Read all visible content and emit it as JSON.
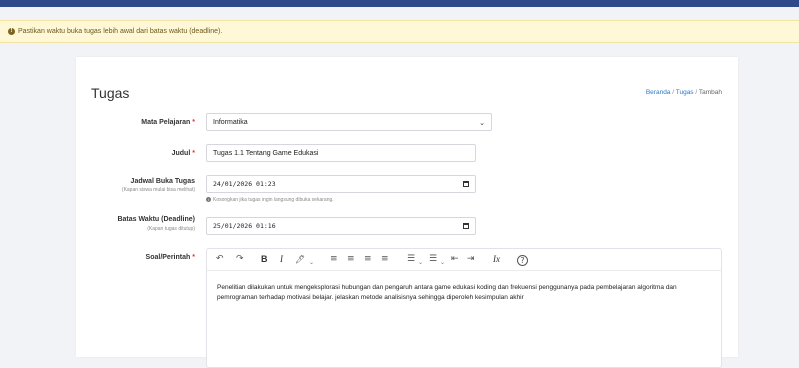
{
  "alert": {
    "icon": "alert-circle-icon",
    "text": "Pastikan waktu buka tugas lebih awal dari batas waktu (deadline)."
  },
  "page": {
    "title": "Tugas",
    "breadcrumb": [
      "Beranda",
      "Tugas",
      "Tambah"
    ]
  },
  "form": {
    "mata_pelajaran": {
      "label": "Mata Pelajaran",
      "value": "Informatika"
    },
    "judul": {
      "label": "Judul",
      "value": "Tugas 1.1 Tentang Game Edukasi"
    },
    "jadwal_buka": {
      "label": "Jadwal Buka Tugas",
      "sublabel": "(Kapan siswa mulai bisa melihat)",
      "value": "24/01/2026 01:23",
      "hint": "Kosongkan jika tugas ingin langsung dibuka sekarang."
    },
    "batas_waktu": {
      "label": "Batas Waktu (Deadline)",
      "sublabel": "(Kapan tugas ditutup)",
      "value": "25/01/2026 01:16"
    },
    "soal": {
      "label": "Soal/Perintah",
      "content": "Penelitian  dilakukan untuk mengeksplorasi hubungan dan pengaruh antara game edukasi koding dan frekuensi penggunanya pada pembelajaran algoritma dan pemrograman terhadap motivasi belajar. jelaskan metode analisisnya sehingga diperoleh kesimpulan akhir"
    },
    "required_mark": "*"
  },
  "toolbar": {
    "undo": "↶",
    "redo": "↷",
    "bold": "B",
    "italic": "I",
    "highlight": "🖊",
    "dropdown": "⌄",
    "align_left": "≡",
    "align_center": "≡",
    "align_right": "≡",
    "justify": "≡",
    "bullet_list": "☰",
    "numbered_list": "☰",
    "outdent": "⇤",
    "indent": "⇥",
    "clear_format": "Ix",
    "help": "?"
  },
  "colors": {
    "topbar": "#2f4a8a",
    "alert_bg": "#fff8d6",
    "link": "#2a7ac8",
    "required": "#e0303b"
  }
}
